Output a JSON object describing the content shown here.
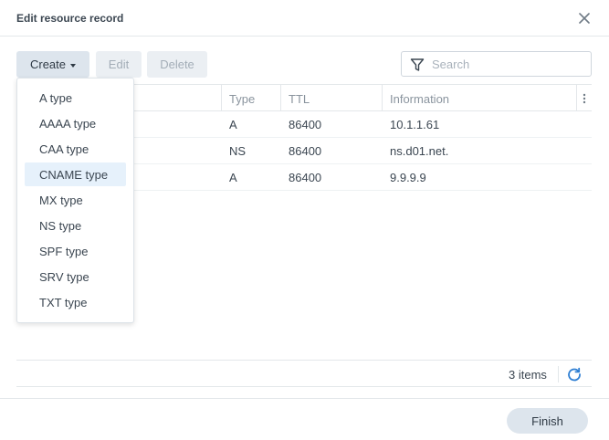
{
  "dialog": {
    "title": "Edit resource record"
  },
  "toolbar": {
    "create_label": "Create",
    "edit_label": "Edit",
    "delete_label": "Delete",
    "search_placeholder": "Search"
  },
  "table": {
    "columns": [
      "Type",
      "TTL",
      "Information"
    ],
    "rows": [
      {
        "type": "A",
        "ttl": "86400",
        "info": "10.1.1.61"
      },
      {
        "type": "NS",
        "ttl": "86400",
        "info": "ns.d01.net."
      },
      {
        "type": "A",
        "ttl": "86400",
        "info": "9.9.9.9"
      }
    ]
  },
  "create_menu": {
    "items": [
      "A type",
      "AAAA type",
      "CAA type",
      "CNAME type",
      "MX type",
      "NS type",
      "SPF type",
      "SRV type",
      "TXT type"
    ],
    "highlighted": "CNAME type"
  },
  "footer": {
    "item_count": "3 items",
    "finish_label": "Finish"
  },
  "icons": {
    "close": "close-icon",
    "filter": "filter-icon",
    "column_menu": "kebab-icon",
    "refresh": "refresh-icon",
    "dropdown": "caret-down-icon"
  },
  "colors": {
    "accent": "#2f7fd3",
    "button_bg": "#dde5ed",
    "menu_highlight": "#e6f1fb",
    "border": "#e3e7ea"
  }
}
